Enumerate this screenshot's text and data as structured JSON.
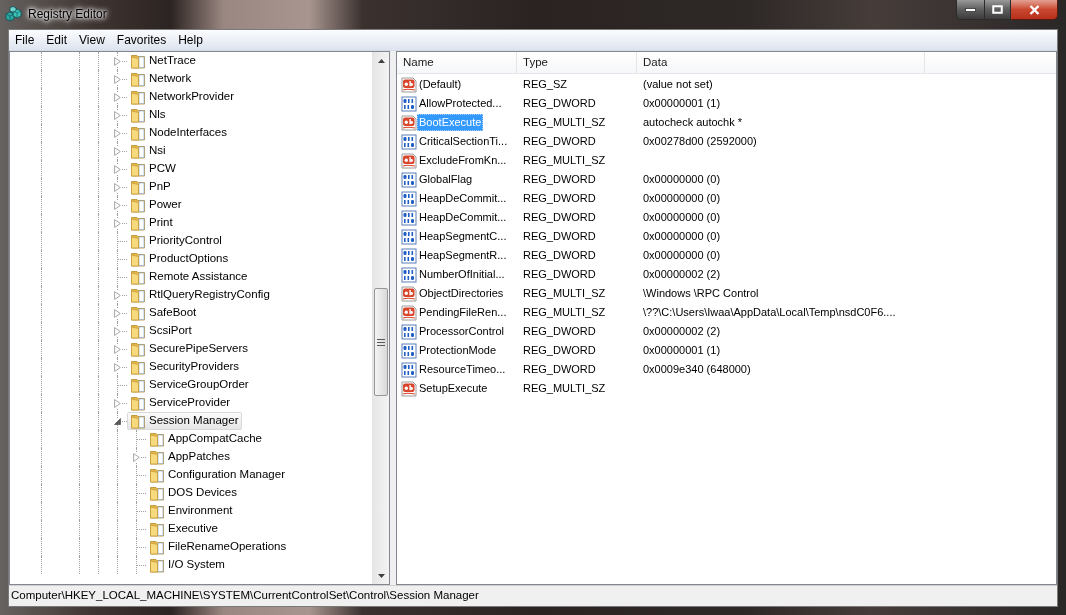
{
  "window": {
    "title": "Registry Editor"
  },
  "menu": [
    {
      "label": "File"
    },
    {
      "label": "Edit"
    },
    {
      "label": "View"
    },
    {
      "label": "Favorites"
    },
    {
      "label": "Help"
    }
  ],
  "tree": {
    "items": [
      {
        "label": "NetTrace",
        "expanded": false,
        "selected": false
      },
      {
        "label": "Network",
        "expanded": false,
        "selected": false
      },
      {
        "label": "NetworkProvider",
        "expanded": false,
        "selected": false
      },
      {
        "label": "Nls",
        "expanded": false,
        "selected": false
      },
      {
        "label": "NodeInterfaces",
        "expanded": false,
        "selected": false
      },
      {
        "label": "Nsi",
        "expanded": false,
        "selected": false
      },
      {
        "label": "PCW",
        "expanded": false,
        "selected": false
      },
      {
        "label": "PnP",
        "expanded": false,
        "selected": false
      },
      {
        "label": "Power",
        "expanded": false,
        "selected": false
      },
      {
        "label": "Print",
        "expanded": false,
        "selected": false
      },
      {
        "label": "PriorityControl",
        "selected": false
      },
      {
        "label": "ProductOptions",
        "selected": false
      },
      {
        "label": "Remote Assistance",
        "selected": false
      },
      {
        "label": "RtlQueryRegistryConfig",
        "expanded": false,
        "selected": false
      },
      {
        "label": "SafeBoot",
        "expanded": false,
        "selected": false
      },
      {
        "label": "ScsiPort",
        "expanded": false,
        "selected": false
      },
      {
        "label": "SecurePipeServers",
        "expanded": false,
        "selected": false
      },
      {
        "label": "SecurityProviders",
        "expanded": false,
        "selected": false
      },
      {
        "label": "ServiceGroupOrder",
        "selected": false
      },
      {
        "label": "ServiceProvider",
        "expanded": false,
        "selected": false
      },
      {
        "label": "Session Manager",
        "expanded": true,
        "selected": true,
        "children": [
          {
            "label": "AppCompatCache",
            "selected": false
          },
          {
            "label": "AppPatches",
            "expanded": false,
            "selected": false
          },
          {
            "label": "Configuration Manager",
            "selected": false
          },
          {
            "label": "DOS Devices",
            "selected": false
          },
          {
            "label": "Environment",
            "selected": false
          },
          {
            "label": "Executive",
            "selected": false
          },
          {
            "label": "FileRenameOperations",
            "selected": false
          },
          {
            "label": "I/O System",
            "selected": false
          }
        ]
      }
    ]
  },
  "values": {
    "columns": [
      "Name",
      "Type",
      "Data"
    ],
    "rows": [
      {
        "name": "(Default)",
        "kind": "string",
        "type": "REG_SZ",
        "data": "(value not set)",
        "selected": false
      },
      {
        "name": "AllowProtected...",
        "kind": "dword",
        "type": "REG_DWORD",
        "data": "0x00000001 (1)",
        "selected": false
      },
      {
        "name": "BootExecute",
        "kind": "string",
        "type": "REG_MULTI_SZ",
        "data": "autocheck autochk *",
        "selected": true
      },
      {
        "name": "CriticalSectionTi...",
        "kind": "dword",
        "type": "REG_DWORD",
        "data": "0x00278d00 (2592000)",
        "selected": false
      },
      {
        "name": "ExcludeFromKn...",
        "kind": "string",
        "type": "REG_MULTI_SZ",
        "selected": false
      },
      {
        "name": "GlobalFlag",
        "kind": "dword",
        "type": "REG_DWORD",
        "data": "0x00000000 (0)",
        "selected": false
      },
      {
        "name": "HeapDeCommit...",
        "kind": "dword",
        "type": "REG_DWORD",
        "data": "0x00000000 (0)",
        "selected": false
      },
      {
        "name": "HeapDeCommit...",
        "kind": "dword",
        "type": "REG_DWORD",
        "data": "0x00000000 (0)",
        "selected": false
      },
      {
        "name": "HeapSegmentC...",
        "kind": "dword",
        "type": "REG_DWORD",
        "data": "0x00000000 (0)",
        "selected": false
      },
      {
        "name": "HeapSegmentR...",
        "kind": "dword",
        "type": "REG_DWORD",
        "data": "0x00000000 (0)",
        "selected": false
      },
      {
        "name": "NumberOfInitial...",
        "kind": "dword",
        "type": "REG_DWORD",
        "data": "0x00000002 (2)",
        "selected": false
      },
      {
        "name": "ObjectDirectories",
        "kind": "string",
        "type": "REG_MULTI_SZ",
        "data": "\\Windows \\RPC Control",
        "selected": false
      },
      {
        "name": "PendingFileRen...",
        "kind": "string",
        "type": "REG_MULTI_SZ",
        "data": "\\??\\C:\\Users\\Iwaa\\AppData\\Local\\Temp\\nsdC0F6....",
        "selected": false
      },
      {
        "name": "ProcessorControl",
        "kind": "dword",
        "type": "REG_DWORD",
        "data": "0x00000002 (2)",
        "selected": false
      },
      {
        "name": "ProtectionMode",
        "kind": "dword",
        "type": "REG_DWORD",
        "data": "0x00000001 (1)",
        "selected": false
      },
      {
        "name": "ResourceTimeo...",
        "kind": "dword",
        "type": "REG_DWORD",
        "data": "0x0009e340 (648000)",
        "selected": false
      },
      {
        "name": "SetupExecute",
        "kind": "string",
        "type": "REG_MULTI_SZ",
        "selected": false
      }
    ]
  },
  "status_bar": {
    "path": "Computer\\HKEY_LOCAL_MACHINE\\SYSTEM\\CurrentControlSet\\Control\\Session Manager"
  }
}
